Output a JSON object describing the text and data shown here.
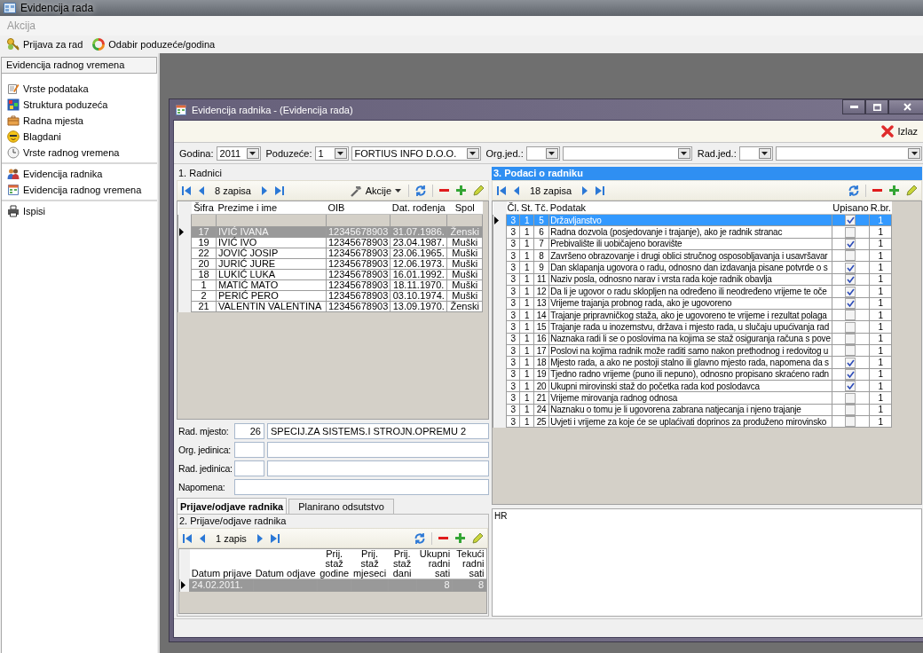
{
  "app": {
    "title": "Evidencija rada",
    "menu": [
      "Akcija"
    ],
    "toolbar": [
      "Prijava za rad",
      "Odabir poduzeće/godina"
    ]
  },
  "sidebar": {
    "header": "Evidencija radnog vremena",
    "groups": [
      [
        "Vrste podataka",
        "Struktura poduzeća",
        "Radna mjesta",
        "Blagdani",
        "Vrste radnog vremena"
      ],
      [
        "Evidencija radnika",
        "Evidencija radnog vremena"
      ],
      [
        "Ispisi"
      ]
    ]
  },
  "window": {
    "title": "Evidencija radnika - (Evidencija rada)",
    "exit_button": "Izlaz"
  },
  "filters": [
    {
      "label": "Godina:",
      "fields": [
        {
          "kind": "year",
          "value": "2011"
        }
      ]
    },
    {
      "label": "Poduzeće:",
      "fields": [
        {
          "kind": "code",
          "value": "1"
        },
        {
          "kind": "name",
          "value": "FORTIUS INFO D.O.O."
        }
      ]
    },
    {
      "label": "Org.jed.:",
      "fields": [
        {
          "kind": "code"
        },
        {
          "kind": "name"
        }
      ]
    },
    {
      "label": "Rad.jed.:",
      "fields": [
        {
          "kind": "code"
        },
        {
          "kind": "wide"
        }
      ]
    }
  ],
  "employees": {
    "title": "1. Radnici",
    "record_count": "8 zapisa",
    "actions_button": "Akcije",
    "columns": [
      "Šifra",
      "Prezime i ime",
      "OIB",
      "Dat. rođenja",
      "Spol"
    ],
    "rows": [
      {
        "cells": [
          "17",
          "IVIĆ IVANA",
          "12345678903",
          "31.07.1986.",
          "Ženski"
        ],
        "selected": true
      },
      {
        "cells": [
          "19",
          "IVIĆ IVO",
          "12345678903",
          "23.04.1987.",
          "Muški"
        ],
        "selected": false
      },
      {
        "cells": [
          "22",
          "JOVIĆ JOSIP",
          "12345678903",
          "23.06.1965.",
          "Muški"
        ],
        "selected": false
      },
      {
        "cells": [
          "20",
          "JURIĆ JURE",
          "12345678903",
          "12.06.1973.",
          "Muški"
        ],
        "selected": false
      },
      {
        "cells": [
          "18",
          "LUKIĆ LUKA",
          "12345678903",
          "16.01.1992.",
          "Muški"
        ],
        "selected": false
      },
      {
        "cells": [
          "1",
          "MATIĆ MATO",
          "12345678903",
          "18.11.1970.",
          "Muški"
        ],
        "selected": false
      },
      {
        "cells": [
          "2",
          "PERIĆ PERO",
          "12345678903",
          "03.10.1974.",
          "Muški"
        ],
        "selected": false
      },
      {
        "cells": [
          "21",
          "VALENTIN VALENTINA",
          "12345678903",
          "13.09.1970.",
          "Ženski"
        ],
        "selected": false
      }
    ]
  },
  "form": [
    {
      "label": "Rad. mjesto:",
      "fields": [
        {
          "kind": "code",
          "value": "26"
        },
        {
          "kind": "name",
          "value": "SPECIJ.ZA SISTEMS.I STROJN.OPREMU 2"
        }
      ]
    },
    {
      "label": "Org. jedinica:",
      "fields": [
        {
          "kind": "code"
        },
        {
          "kind": "name"
        }
      ]
    },
    {
      "label": "Rad. jedinica:",
      "fields": [
        {
          "kind": "code"
        },
        {
          "kind": "name"
        }
      ]
    },
    {
      "label": "Napomena:",
      "fields": [
        {
          "kind": "wide"
        }
      ]
    }
  ],
  "tabs": [
    {
      "label": "Prijave/odjave radnika",
      "selected": true
    },
    {
      "label": "Planirano odsutstvo",
      "selected": false
    }
  ],
  "registrations": {
    "title": "2. Prijave/odjave radnika",
    "record_count": "1 zapis",
    "columns": [
      "Datum prijave",
      "Datum odjave",
      "Prij. staž godine",
      "Prij. staž mjeseci",
      "Prij. staž dani",
      "Ukupni radni sati",
      "Tekući radni sati"
    ],
    "rows": [
      {
        "cells": [
          "24.02.2011.",
          null,
          null,
          null,
          null,
          "8",
          "8"
        ],
        "selected": true
      }
    ]
  },
  "details": {
    "title": "3. Podaci o radniku",
    "record_count": "18 zapisa",
    "columns": [
      "Čl.",
      "St.",
      "Tč.",
      "Podatak",
      "Upisano",
      "R.br."
    ],
    "rows": [
      {
        "cells": [
          "3",
          "1",
          "5",
          "Državljanstvo"
        ],
        "checked": true,
        "number": "1",
        "selected": true
      },
      {
        "cells": [
          "3",
          "1",
          "6",
          "Radna dozvola (posjedovanje i trajanje), ako je radnik stranac"
        ],
        "checked": false,
        "number": "1",
        "selected": false
      },
      {
        "cells": [
          "3",
          "1",
          "7",
          "Prebivalište ili uobičajeno boravište"
        ],
        "checked": true,
        "number": "1",
        "selected": false
      },
      {
        "cells": [
          "3",
          "1",
          "8",
          "Završeno obrazovanje i drugi oblici stručnog osposobljavanja i usavršavar"
        ],
        "checked": false,
        "number": "1",
        "selected": false
      },
      {
        "cells": [
          "3",
          "1",
          "9",
          "Dan sklapanja ugovora o radu, odnosno dan izdavanja pisane potvrde o s"
        ],
        "checked": true,
        "number": "1",
        "selected": false
      },
      {
        "cells": [
          "3",
          "1",
          "11",
          "Naziv posla, odnosno narav i vrsta rada koje radnik obavlja"
        ],
        "checked": true,
        "number": "1",
        "selected": false
      },
      {
        "cells": [
          "3",
          "1",
          "12",
          "Da li je ugovor o radu sklopljen na određeno ili neodređeno vrijeme te oče"
        ],
        "checked": true,
        "number": "1",
        "selected": false
      },
      {
        "cells": [
          "3",
          "1",
          "13",
          "Vrijeme trajanja probnog rada, ako je ugovoreno"
        ],
        "checked": true,
        "number": "1",
        "selected": false
      },
      {
        "cells": [
          "3",
          "1",
          "14",
          "Trajanje pripravničkog staža, ako je ugovoreno te vrijeme i rezultat polaga"
        ],
        "checked": false,
        "number": "1",
        "selected": false
      },
      {
        "cells": [
          "3",
          "1",
          "15",
          "Trajanje rada u inozemstvu, država i mjesto rada, u slučaju upućivanja rad"
        ],
        "checked": false,
        "number": "1",
        "selected": false
      },
      {
        "cells": [
          "3",
          "1",
          "16",
          "Naznaka radi li se o poslovima na kojima se staž osiguranja računa s pove"
        ],
        "checked": false,
        "number": "1",
        "selected": false
      },
      {
        "cells": [
          "3",
          "1",
          "17",
          "Poslovi na kojima radnik može raditi samo nakon prethodnog i redovitog u"
        ],
        "checked": false,
        "number": "1",
        "selected": false
      },
      {
        "cells": [
          "3",
          "1",
          "18",
          "Mjesto rada, a ako ne postoji stalno ili glavno mjesto rada, napomena da s"
        ],
        "checked": true,
        "number": "1",
        "selected": false
      },
      {
        "cells": [
          "3",
          "1",
          "19",
          "Tjedno radno vrijeme (puno ili nepuno), odnosno propisano skraćeno radn"
        ],
        "checked": true,
        "number": "1",
        "selected": false
      },
      {
        "cells": [
          "3",
          "1",
          "20",
          "Ukupni mirovinski staž do početka rada kod poslodavca"
        ],
        "checked": true,
        "number": "1",
        "selected": false
      },
      {
        "cells": [
          "3",
          "1",
          "21",
          "Vrijeme mirovanja radnog odnosa"
        ],
        "checked": false,
        "number": "1",
        "selected": false
      },
      {
        "cells": [
          "3",
          "1",
          "24",
          "Naznaku o tomu je li ugovorena zabrana natjecanja i njeno trajanje"
        ],
        "checked": false,
        "number": "1",
        "selected": false
      },
      {
        "cells": [
          "3",
          "1",
          "25",
          "Uvjeti i vrijeme za koje će se uplaćivati doprinos za produženo mirovinsko"
        ],
        "checked": false,
        "number": "1",
        "selected": false
      }
    ]
  },
  "notes": {
    "value": "HR"
  }
}
